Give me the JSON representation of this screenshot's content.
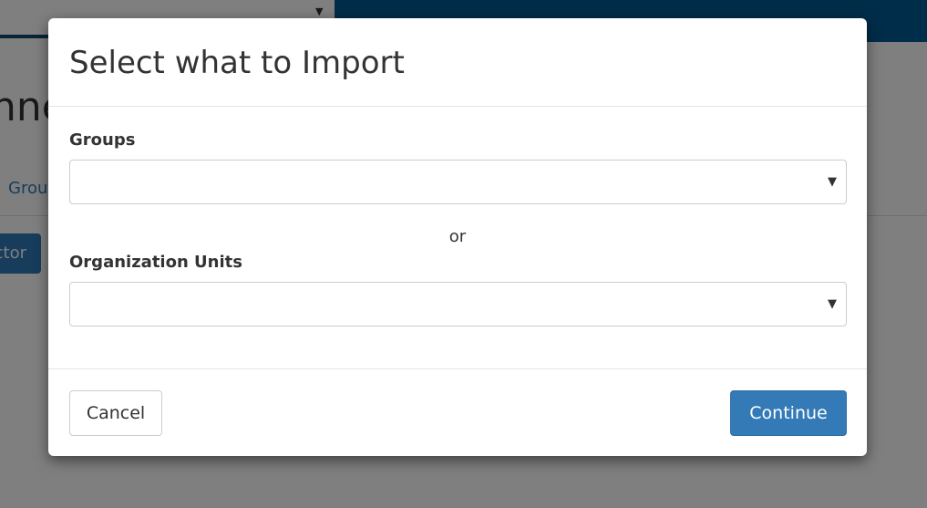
{
  "background": {
    "heading_fragment": "nne",
    "tab_fragment": "Grou",
    "button_fragment": "ctor",
    "dropdown_caret_icon": "caret-down-icon",
    "colors": {
      "topbar_right": "#005a92",
      "topbar_border": "#0f4a73",
      "link": "#337ab7",
      "button": "#2e79b9"
    }
  },
  "modal": {
    "title": "Select what to Import",
    "groups": {
      "label": "Groups",
      "selected_value": "",
      "caret_icon": "caret-down-icon"
    },
    "separator": "or",
    "org_units": {
      "label": "Organization Units",
      "selected_value": "",
      "caret_icon": "caret-down-icon"
    },
    "footer": {
      "cancel_label": "Cancel",
      "continue_label": "Continue"
    },
    "colors": {
      "primary": "#337ab7",
      "border": "#cccccc",
      "text": "#333333"
    }
  }
}
